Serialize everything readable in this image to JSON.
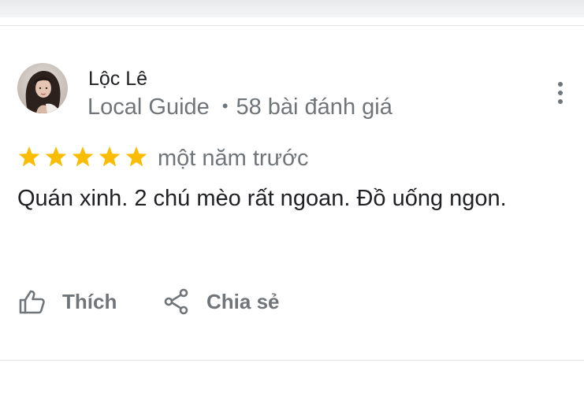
{
  "review": {
    "author": {
      "name": "Lộc Lê",
      "badge": "Local Guide",
      "review_count": "58 bài đánh giá",
      "avatar_icon": "user-avatar-photo"
    },
    "rating": 5,
    "rating_max": 5,
    "star_color": "#fbbc04",
    "time": "một năm trước",
    "text": "Quán xinh. 2 chú mèo rất ngoan. Đồ uống ngon.",
    "actions": {
      "like_label": "Thích",
      "share_label": "Chia sẻ"
    },
    "icons": {
      "like": "thumbs-up-icon",
      "share": "share-icon",
      "menu": "more-vert-icon"
    }
  }
}
